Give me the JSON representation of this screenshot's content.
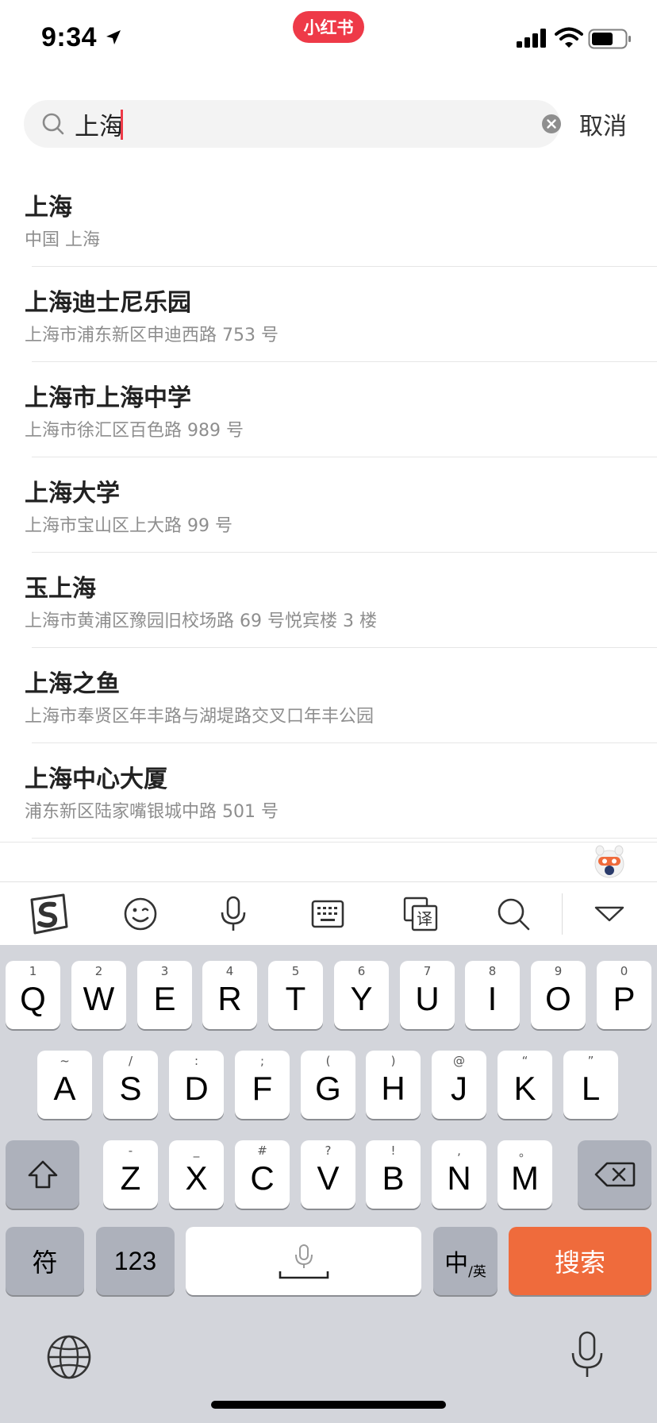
{
  "status_bar": {
    "time": "9:34",
    "app_badge": "小红书",
    "icons": [
      "location-arrow-icon",
      "signal-icon",
      "wifi-icon",
      "battery-icon"
    ]
  },
  "search": {
    "value": "上海",
    "cancel_label": "取消",
    "icons": [
      "search-icon",
      "clear-icon"
    ]
  },
  "results": [
    {
      "title": "上海",
      "address": "中国 上海"
    },
    {
      "title": "上海迪士尼乐园",
      "address": "上海市浦东新区申迪西路 753 号"
    },
    {
      "title": "上海市上海中学",
      "address": "上海市徐汇区百色路 989 号"
    },
    {
      "title": "上海大学",
      "address": "上海市宝山区上大路 99 号"
    },
    {
      "title": "玉上海",
      "address": "上海市黄浦区豫园旧校场路 69 号悦宾楼 3 楼"
    },
    {
      "title": "上海之鱼",
      "address": "上海市奉贤区年丰路与湖堤路交叉口年丰公园"
    },
    {
      "title": "上海中心大厦",
      "address": "浦东新区陆家嘴银城中路 501 号"
    }
  ],
  "ime_toolbar": {
    "items": [
      "sogou-logo-icon",
      "emoji-icon",
      "microphone-icon",
      "keyboard-icon",
      "translate-icon",
      "search-icon",
      "collapse-icon"
    ],
    "translate_glyph": "译"
  },
  "keyboard": {
    "row1": [
      {
        "letter": "Q",
        "hint": "1"
      },
      {
        "letter": "W",
        "hint": "2"
      },
      {
        "letter": "E",
        "hint": "3"
      },
      {
        "letter": "R",
        "hint": "4"
      },
      {
        "letter": "T",
        "hint": "5"
      },
      {
        "letter": "Y",
        "hint": "6"
      },
      {
        "letter": "U",
        "hint": "7"
      },
      {
        "letter": "I",
        "hint": "8"
      },
      {
        "letter": "O",
        "hint": "9"
      },
      {
        "letter": "P",
        "hint": "0"
      }
    ],
    "row2": [
      {
        "letter": "A",
        "hint": "~"
      },
      {
        "letter": "S",
        "hint": "/"
      },
      {
        "letter": "D",
        "hint": ":"
      },
      {
        "letter": "F",
        "hint": ";"
      },
      {
        "letter": "G",
        "hint": "("
      },
      {
        "letter": "H",
        "hint": ")"
      },
      {
        "letter": "J",
        "hint": "@"
      },
      {
        "letter": "K",
        "hint": "“"
      },
      {
        "letter": "L",
        "hint": "”"
      }
    ],
    "row3": [
      {
        "letter": "Z",
        "hint": "-"
      },
      {
        "letter": "X",
        "hint": "_"
      },
      {
        "letter": "C",
        "hint": "#"
      },
      {
        "letter": "V",
        "hint": "?"
      },
      {
        "letter": "B",
        "hint": "!"
      },
      {
        "letter": "N",
        "hint": ","
      },
      {
        "letter": "M",
        "hint": "。"
      }
    ],
    "symbols_label": "符",
    "numbers_label": "123",
    "lang_main": "中",
    "lang_sub": "/英",
    "search_label": "搜索",
    "accent_color": "#ef6b3c"
  }
}
